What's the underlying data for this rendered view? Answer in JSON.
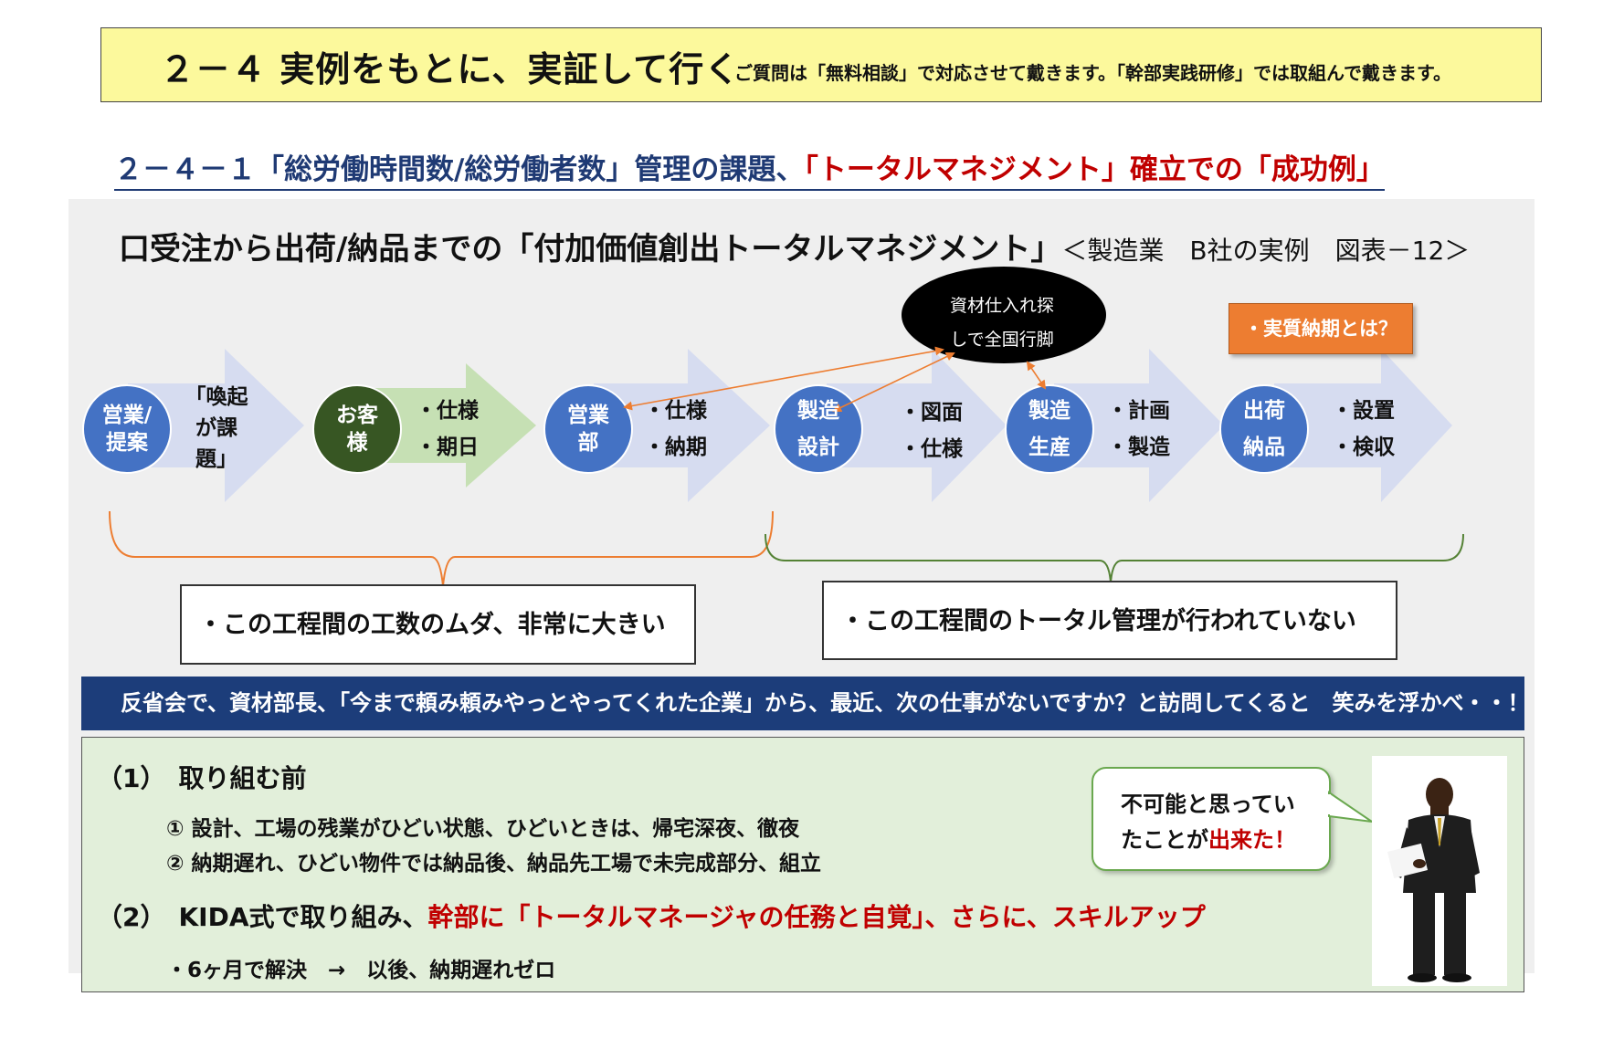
{
  "header": {
    "title": "２－４ 実例をもとに、実証して行く",
    "note": "ご質問は「無料相談」で対応させて戴きます。「幹部実践研修」では取組んで戴きます。"
  },
  "subheading": {
    "prefix": "２－４－１「総労働時間数/総労働者数」管理の課題、",
    "highlight": "「トータルマネジメント」確立での「成功例」"
  },
  "diagram": {
    "title": "口受注から出荷/納品までの「付加価値創出トータルマネジメント」",
    "reference": "＜製造業　B社の実例　図表－12＞",
    "bubble": [
      "資材仕入れ探",
      "しで全国行脚"
    ],
    "callout": "・実質納期とは？",
    "steps": [
      {
        "circle": [
          "営業/",
          "提案"
        ],
        "arrow_lines": [
          "「喚起",
          "が課",
          "題」"
        ]
      },
      {
        "circle": [
          "お客",
          "様"
        ],
        "arrow_lines": [
          "・仕様",
          "・期日"
        ]
      },
      {
        "circle": [
          "営業",
          "部"
        ],
        "arrow_lines": [
          "・仕様",
          "・納期"
        ]
      },
      {
        "circle": [
          "製造",
          "設計"
        ],
        "arrow_lines": [
          "・図面",
          "・仕様"
        ]
      },
      {
        "circle": [
          "製造",
          "生産"
        ],
        "arrow_lines": [
          "・計画",
          "・製造"
        ]
      },
      {
        "circle": [
          "出荷",
          "納品"
        ],
        "arrow_lines": [
          "・設置",
          "・検収"
        ]
      }
    ],
    "note_left": "・この工程間の工数のムダ、非常に大きい",
    "note_right": "・この工程間のトータル管理が行われていない"
  },
  "banner": "反省会で、資材部長、「今まで頼み頼みやっとやってくれた企業」から、最近、次の仕事がないですか？と訪問してくると　笑みを浮かべ・・！",
  "before": {
    "title": "（1）　取り組む前",
    "items": [
      "①  設計、工場の残業がひどい状態、ひどいときは、帰宅深夜、徹夜",
      "②  納期遅れ、ひどい物件では納品後、納品先工場で未完成部分、組立"
    ]
  },
  "after": {
    "title_prefix": "（2）　KIDA式で取り組み、",
    "title_highlight": "幹部に「トータルマネージャの任務と自覚」、さらに、スキルアップ",
    "result": "・6ヶ月で解決　→　以後、納期遅れゼロ"
  },
  "speech": {
    "line1": "不可能と思ってい",
    "line2_prefix": "たことが",
    "line2_highlight": "出来た！"
  },
  "colors": {
    "title_bg": "#fcf99c",
    "circle_blue": "#4472c4",
    "circle_green": "#375623",
    "arrow_blue": "#d6dcf0",
    "arrow_green": "#c6e0b4",
    "banner": "#1c3d7a",
    "green_box": "#e2efda",
    "callout_orange": "#ed7d31",
    "accent_red": "#c00000",
    "brace_orange": "#ed7d31",
    "brace_green": "#548235"
  }
}
